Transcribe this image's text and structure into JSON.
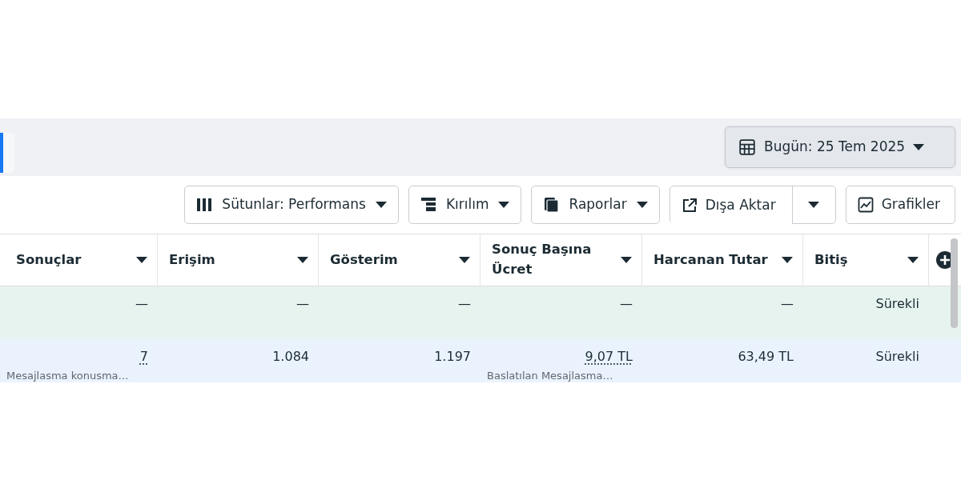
{
  "date_button": {
    "label": "Bugün: 25 Tem 2025"
  },
  "toolbar": [
    {
      "kind": "dropdown",
      "label": "Sütunlar: Performans"
    },
    {
      "kind": "dropdown",
      "label": "Kırılım"
    },
    {
      "kind": "dropdown",
      "label": "Raporlar"
    },
    {
      "kind": "split",
      "label": "Dışa Aktar"
    },
    {
      "kind": "plain",
      "label": "Grafikler"
    }
  ],
  "table": {
    "columns": [
      "Sonuçlar",
      "Erişim",
      "Gösterim",
      "Sonuç Başına Ücret",
      "Harcanan Tutar",
      "Bitiş"
    ],
    "rows": [
      {
        "kind": "summary",
        "cells": [
          {
            "value": "—"
          },
          {
            "value": "—"
          },
          {
            "value": "—"
          },
          {
            "value": "—"
          },
          {
            "value": "—"
          },
          {
            "value": "Sürekli"
          }
        ]
      },
      {
        "kind": "item",
        "cells": [
          {
            "value": "7",
            "underlined": true,
            "sub": "Mesajlasma konusma…"
          },
          {
            "value": "1.084"
          },
          {
            "value": "1.197"
          },
          {
            "value": "9,07 TL",
            "underlined": true,
            "sub": "Baslatılan Mesajlasma…"
          },
          {
            "value": "63,49 TL"
          },
          {
            "value": "Sürekli"
          }
        ]
      }
    ]
  }
}
